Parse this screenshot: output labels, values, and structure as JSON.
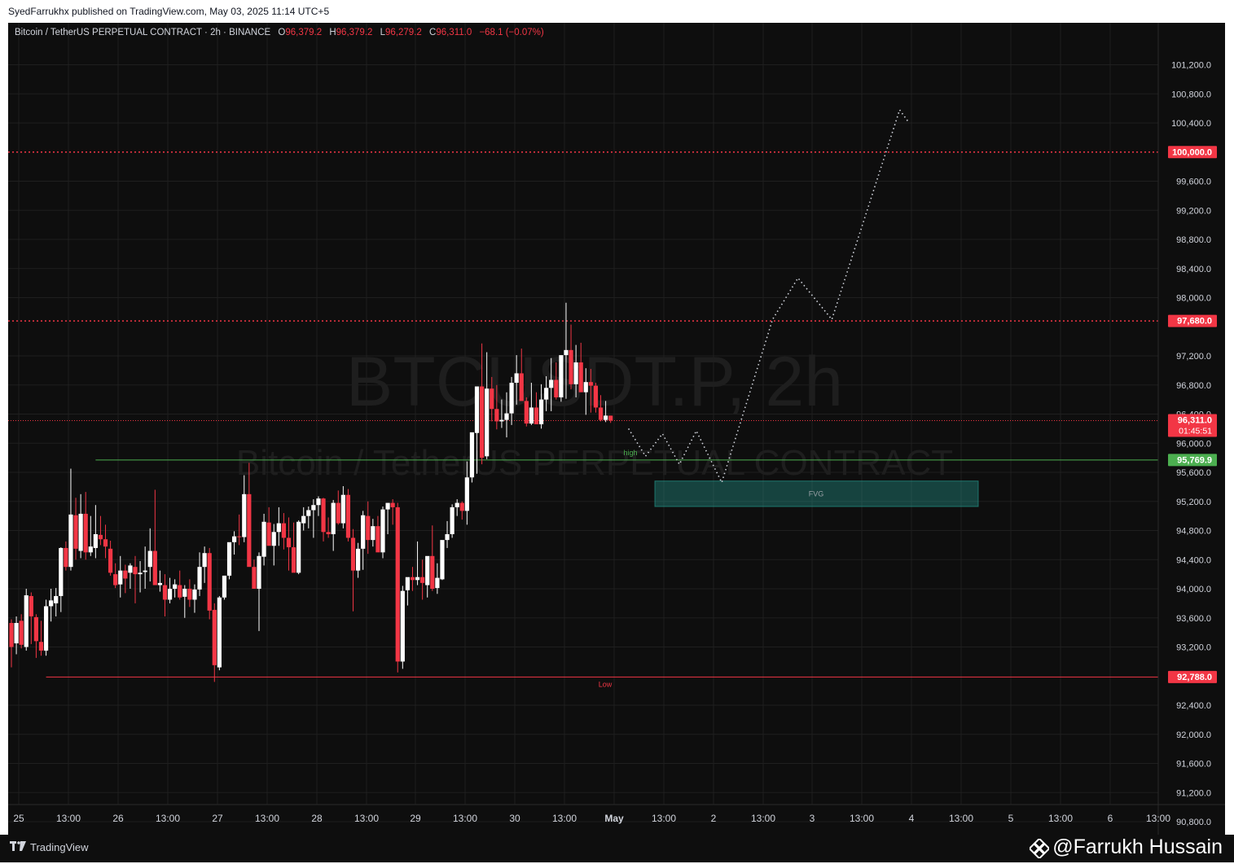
{
  "header": {
    "publish_text": "SyedFarrukhx published on TradingView.com, May 03, 2025 11:14 UTC+5"
  },
  "legend": {
    "symbol": "Bitcoin / TetherUS PERPETUAL CONTRACT · 2h · BINANCE",
    "o_label": "O",
    "o_value": "96,379.2",
    "h_label": "H",
    "h_value": "96,379.2",
    "l_label": "L",
    "l_value": "96,279.2",
    "c_label": "C",
    "c_value": "96,311.0",
    "change": "−68.1 (−0.07%)"
  },
  "watermark": {
    "line1": "BTCUSDT.P, 2h",
    "line2": "Bitcoin / TetherUS PERPETUAL CONTRACT"
  },
  "colors": {
    "background": "#0e0e0e",
    "grid": "#1f1f1f",
    "up": "#ffffff",
    "down": "#f23645",
    "high_line": "#4caf50",
    "fvg_fill": "#26a69a",
    "text": "#d1d4dc"
  },
  "chart_data": {
    "type": "candlestick",
    "symbol": "BTCUSDT.P",
    "timeframe": "2h",
    "exchange": "BINANCE",
    "y_ticks": [
      "101,200.0",
      "100,800.0",
      "100,400.0",
      "99,600.0",
      "99,200.0",
      "98,800.0",
      "98,400.0",
      "98,000.0",
      "97,200.0",
      "96,800.0",
      "96,400.0",
      "96,000.0",
      "95,600.0",
      "95,200.0",
      "94,800.0",
      "94,400.0",
      "94,000.0",
      "93,600.0",
      "93,200.0",
      "92,400.0",
      "92,000.0",
      "91,600.0",
      "91,200.0",
      "90,800.0"
    ],
    "ylim": [
      90600,
      101450
    ],
    "x_ticks": [
      "25",
      "13:00",
      "26",
      "13:00",
      "27",
      "13:00",
      "28",
      "13:00",
      "29",
      "13:00",
      "30",
      "13:00",
      "May",
      "13:00",
      "2",
      "13:00",
      "3",
      "13:00",
      "4",
      "13:00",
      "5",
      "13:00",
      "6",
      "13:00"
    ],
    "price_labels": [
      {
        "value": 100000,
        "label": "100,000.0",
        "kind": "dotted-level"
      },
      {
        "value": 97680,
        "label": "97,680.0",
        "kind": "dotted-level"
      },
      {
        "value": 96311,
        "label": "96,311.0",
        "sub": "01:45:51",
        "kind": "current-price"
      },
      {
        "value": 95769.9,
        "label": "95,769.9",
        "kind": "high-line"
      },
      {
        "value": 92788,
        "label": "92,788.0",
        "kind": "low-line"
      }
    ],
    "annotations": {
      "high_text": "high",
      "low_text": "Low",
      "fvg_text": "FVG",
      "fvg_top": 95480,
      "fvg_bottom": 95130
    },
    "projection": [
      [
        0,
        96200
      ],
      [
        2,
        95820
      ],
      [
        4,
        96130
      ],
      [
        6,
        95710
      ],
      [
        8,
        96170
      ],
      [
        11,
        95460
      ],
      [
        17,
        97700
      ],
      [
        20,
        98270
      ],
      [
        24,
        97700
      ],
      [
        32,
        100580
      ],
      [
        33,
        100420
      ]
    ],
    "candles": [
      [
        93530,
        93580,
        92920,
        93200
      ],
      [
        93250,
        93620,
        93100,
        93530
      ],
      [
        93560,
        93650,
        93180,
        93230
      ],
      [
        93200,
        94000,
        93150,
        93910
      ],
      [
        93900,
        93950,
        93240,
        93620
      ],
      [
        93610,
        93650,
        93050,
        93280
      ],
      [
        93270,
        93560,
        93080,
        93150
      ],
      [
        93150,
        93850,
        93080,
        93760
      ],
      [
        93760,
        94000,
        93550,
        93840
      ],
      [
        93800,
        94010,
        93620,
        93900
      ],
      [
        93900,
        94570,
        93680,
        94560
      ],
      [
        94560,
        94650,
        94250,
        94300
      ],
      [
        94300,
        95650,
        94250,
        95020
      ],
      [
        95010,
        95250,
        94400,
        94550
      ],
      [
        94520,
        95300,
        94420,
        95030
      ],
      [
        95030,
        95330,
        94400,
        94500
      ],
      [
        94500,
        95000,
        94450,
        94580
      ],
      [
        94560,
        95150,
        94420,
        94750
      ],
      [
        94740,
        95000,
        94600,
        94680
      ],
      [
        94680,
        94880,
        94420,
        94580
      ],
      [
        94550,
        94660,
        94180,
        94220
      ],
      [
        94200,
        94350,
        94010,
        94050
      ],
      [
        94060,
        94450,
        93880,
        94250
      ],
      [
        94250,
        94330,
        93940,
        94140
      ],
      [
        94220,
        94350,
        94000,
        94320
      ],
      [
        94300,
        94450,
        93800,
        94200
      ],
      [
        94200,
        94380,
        93950,
        94220
      ],
      [
        94230,
        94580,
        94000,
        94250
      ],
      [
        94300,
        94830,
        94100,
        94520
      ],
      [
        94520,
        95360,
        94060,
        94050
      ],
      [
        94050,
        94250,
        93960,
        94080
      ],
      [
        94050,
        94200,
        93620,
        93850
      ],
      [
        93850,
        94150,
        93800,
        94000
      ],
      [
        94000,
        94130,
        93880,
        94060
      ],
      [
        94050,
        94250,
        93850,
        93880
      ],
      [
        93890,
        94050,
        93600,
        94000
      ],
      [
        94000,
        94130,
        93750,
        93850
      ],
      [
        93850,
        94060,
        93670,
        93990
      ],
      [
        93990,
        94500,
        93900,
        94300
      ],
      [
        94300,
        94580,
        94080,
        94490
      ],
      [
        94490,
        94560,
        93580,
        93700
      ],
      [
        93710,
        93800,
        92720,
        92950
      ],
      [
        92920,
        93900,
        92880,
        93880
      ],
      [
        93880,
        94180,
        93850,
        94180
      ],
      [
        94180,
        94630,
        94130,
        94640
      ],
      [
        94640,
        94790,
        94470,
        94720
      ],
      [
        94720,
        95020,
        94600,
        94710
      ],
      [
        94710,
        95560,
        94640,
        95300
      ],
      [
        95300,
        95730,
        94900,
        94300
      ],
      [
        94300,
        94400,
        94040,
        94000
      ],
      [
        94000,
        94500,
        93420,
        94450
      ],
      [
        94440,
        95030,
        94320,
        94920
      ],
      [
        94910,
        95120,
        94640,
        94590
      ],
      [
        94590,
        94890,
        94320,
        94780
      ],
      [
        94780,
        95120,
        94590,
        94900
      ],
      [
        94900,
        95040,
        94540,
        94700
      ],
      [
        94700,
        94980,
        94250,
        94570
      ],
      [
        94570,
        94910,
        94300,
        94220
      ],
      [
        94220,
        94940,
        94200,
        94920
      ],
      [
        94900,
        95120,
        94800,
        95000
      ],
      [
        95000,
        95130,
        94830,
        95080
      ],
      [
        95080,
        95230,
        94700,
        95150
      ],
      [
        95150,
        95270,
        95000,
        95240
      ],
      [
        95240,
        95250,
        94650,
        94780
      ],
      [
        94780,
        94980,
        94700,
        94750
      ],
      [
        94750,
        95220,
        94520,
        95180
      ],
      [
        95180,
        95350,
        94880,
        94900
      ],
      [
        94900,
        95410,
        94830,
        95290
      ],
      [
        95290,
        95370,
        94650,
        94700
      ],
      [
        94700,
        94820,
        93690,
        94250
      ],
      [
        94250,
        94630,
        94150,
        94550
      ],
      [
        94550,
        95070,
        94260,
        95010
      ],
      [
        95000,
        95200,
        94480,
        94670
      ],
      [
        94670,
        94960,
        94580,
        94860
      ],
      [
        94860,
        95000,
        94640,
        94500
      ],
      [
        94500,
        95130,
        94420,
        95090
      ],
      [
        95090,
        95140,
        94750,
        95180
      ],
      [
        95180,
        95230,
        94880,
        95120
      ],
      [
        95120,
        95180,
        92850,
        93000
      ],
      [
        93000,
        94040,
        92900,
        93970
      ],
      [
        93980,
        94060,
        93770,
        94160
      ],
      [
        94160,
        94300,
        93970,
        94120
      ],
      [
        94120,
        94650,
        94050,
        94160
      ],
      [
        94160,
        94400,
        93850,
        94080
      ],
      [
        94050,
        94220,
        93880,
        94450
      ],
      [
        94450,
        94870,
        93970,
        94000
      ],
      [
        94010,
        94350,
        93930,
        94150
      ],
      [
        94130,
        94600,
        94120,
        94670
      ],
      [
        94670,
        94930,
        94560,
        94750
      ],
      [
        94750,
        95160,
        94700,
        95120
      ],
      [
        95120,
        95230,
        95000,
        95180
      ],
      [
        95180,
        95200,
        94950,
        95070
      ],
      [
        95070,
        95750,
        94880,
        95530
      ],
      [
        95530,
        96140,
        95460,
        96150
      ],
      [
        96140,
        96770,
        95580,
        96780
      ],
      [
        96780,
        97370,
        95710,
        95800
      ],
      [
        95820,
        97250,
        95780,
        96750
      ],
      [
        96750,
        96910,
        96300,
        96470
      ],
      [
        96470,
        96800,
        96190,
        96300
      ],
      [
        96300,
        96600,
        96210,
        96320
      ],
      [
        96320,
        96700,
        96080,
        96410
      ],
      [
        96410,
        96910,
        96250,
        96830
      ],
      [
        96830,
        97210,
        96530,
        96960
      ],
      [
        96960,
        97300,
        96730,
        96580
      ],
      [
        96580,
        96630,
        96230,
        96270
      ],
      [
        96270,
        96830,
        96250,
        96490
      ],
      [
        96490,
        96700,
        96280,
        96260
      ],
      [
        96260,
        96810,
        96200,
        96600
      ],
      [
        96600,
        96920,
        96440,
        96760
      ],
      [
        96760,
        97170,
        96440,
        96870
      ],
      [
        96870,
        97110,
        96600,
        96630
      ],
      [
        96630,
        97190,
        96570,
        97210
      ],
      [
        97210,
        97930,
        96610,
        97280
      ],
      [
        97280,
        97630,
        96740,
        96810
      ],
      [
        96810,
        97350,
        96630,
        97110
      ],
      [
        97110,
        97380,
        96800,
        96700
      ],
      [
        96700,
        97030,
        96390,
        96840
      ],
      [
        96840,
        97020,
        96420,
        96790
      ],
      [
        96790,
        96830,
        96420,
        96490
      ],
      [
        96490,
        96660,
        96300,
        96320
      ],
      [
        96320,
        96580,
        96290,
        96379
      ],
      [
        96379,
        96379,
        96279,
        96311
      ]
    ]
  },
  "footer": {
    "brand": "TradingView",
    "handle": "@Farrukh Hussain"
  }
}
